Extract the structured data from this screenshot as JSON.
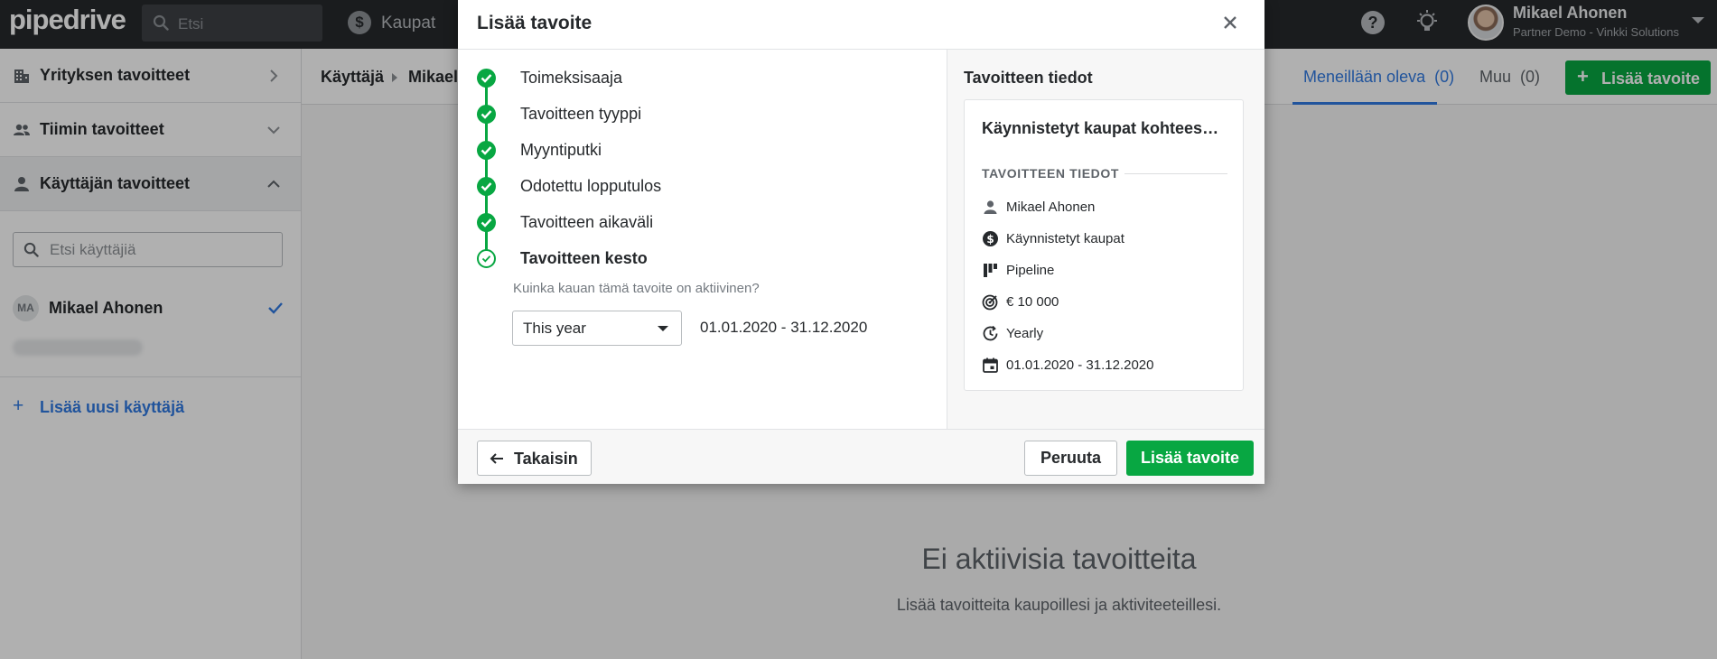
{
  "topbar": {
    "logo": "pipedrive",
    "search_placeholder": "Etsi",
    "nav_deals": "Kaupat",
    "user_name": "Mikael Ahonen",
    "user_company": "Partner Demo - Vinkki Solutions"
  },
  "sidebar": {
    "company_goals": "Yrityksen tavoitteet",
    "team_goals": "Tiimin tavoitteet",
    "user_goals": "Käyttäjän tavoitteet",
    "user_search_placeholder": "Etsi käyttäjiä",
    "user_initials": "MA",
    "user_name": "Mikael Ahonen",
    "add_user": "Lisää uusi käyttäjä"
  },
  "main": {
    "breadcrumb": [
      "Käyttäjä",
      "Mikael"
    ],
    "tab_ongoing": "Meneillään oleva",
    "tab_ongoing_count": "(0)",
    "tab_other": "Muu",
    "tab_other_count": "(0)",
    "add_goal_button": "Lisää tavoite",
    "empty_title": "Ei aktiivisia tavoitteita",
    "empty_subtitle": "Lisää tavoitteita kaupoillesi ja aktiviteeteillesi."
  },
  "modal": {
    "title": "Lisää tavoite",
    "steps": [
      {
        "label": "Toimeksisaaja",
        "status": "done"
      },
      {
        "label": "Tavoitteen tyyppi",
        "status": "done"
      },
      {
        "label": "Myyntiputki",
        "status": "done"
      },
      {
        "label": "Odotettu lopputulos",
        "status": "done"
      },
      {
        "label": "Tavoitteen aikaväli",
        "status": "done"
      },
      {
        "label": "Tavoitteen kesto",
        "status": "current"
      }
    ],
    "duration_question": "Kuinka kauan tämä tavoite on aktiivinen?",
    "period_selected": "This year",
    "period_range": "01.01.2020 - 31.12.2020",
    "summary": {
      "heading": "Tavoitteen tiedot",
      "goal_name": "Käynnistetyt kaupat kohtees…",
      "section_label": "TAVOITTEEN TIEDOT",
      "details": [
        {
          "icon": "person-icon",
          "text": "Mikael Ahonen"
        },
        {
          "icon": "dollar-icon",
          "text": "Käynnistetyt kaupat"
        },
        {
          "icon": "pipeline-icon",
          "text": "Pipeline"
        },
        {
          "icon": "target-icon",
          "text": "€ 10 000"
        },
        {
          "icon": "interval-icon",
          "text": "Yearly"
        },
        {
          "icon": "calendar-icon",
          "text": "01.01.2020 - 31.12.2020"
        }
      ]
    },
    "back_button": "Takaisin",
    "cancel_button": "Peruuta",
    "submit_button": "Lisää tavoite"
  },
  "colors": {
    "accent_green": "#08a742",
    "link_blue": "#317ae2",
    "topbar": "#26292c"
  }
}
